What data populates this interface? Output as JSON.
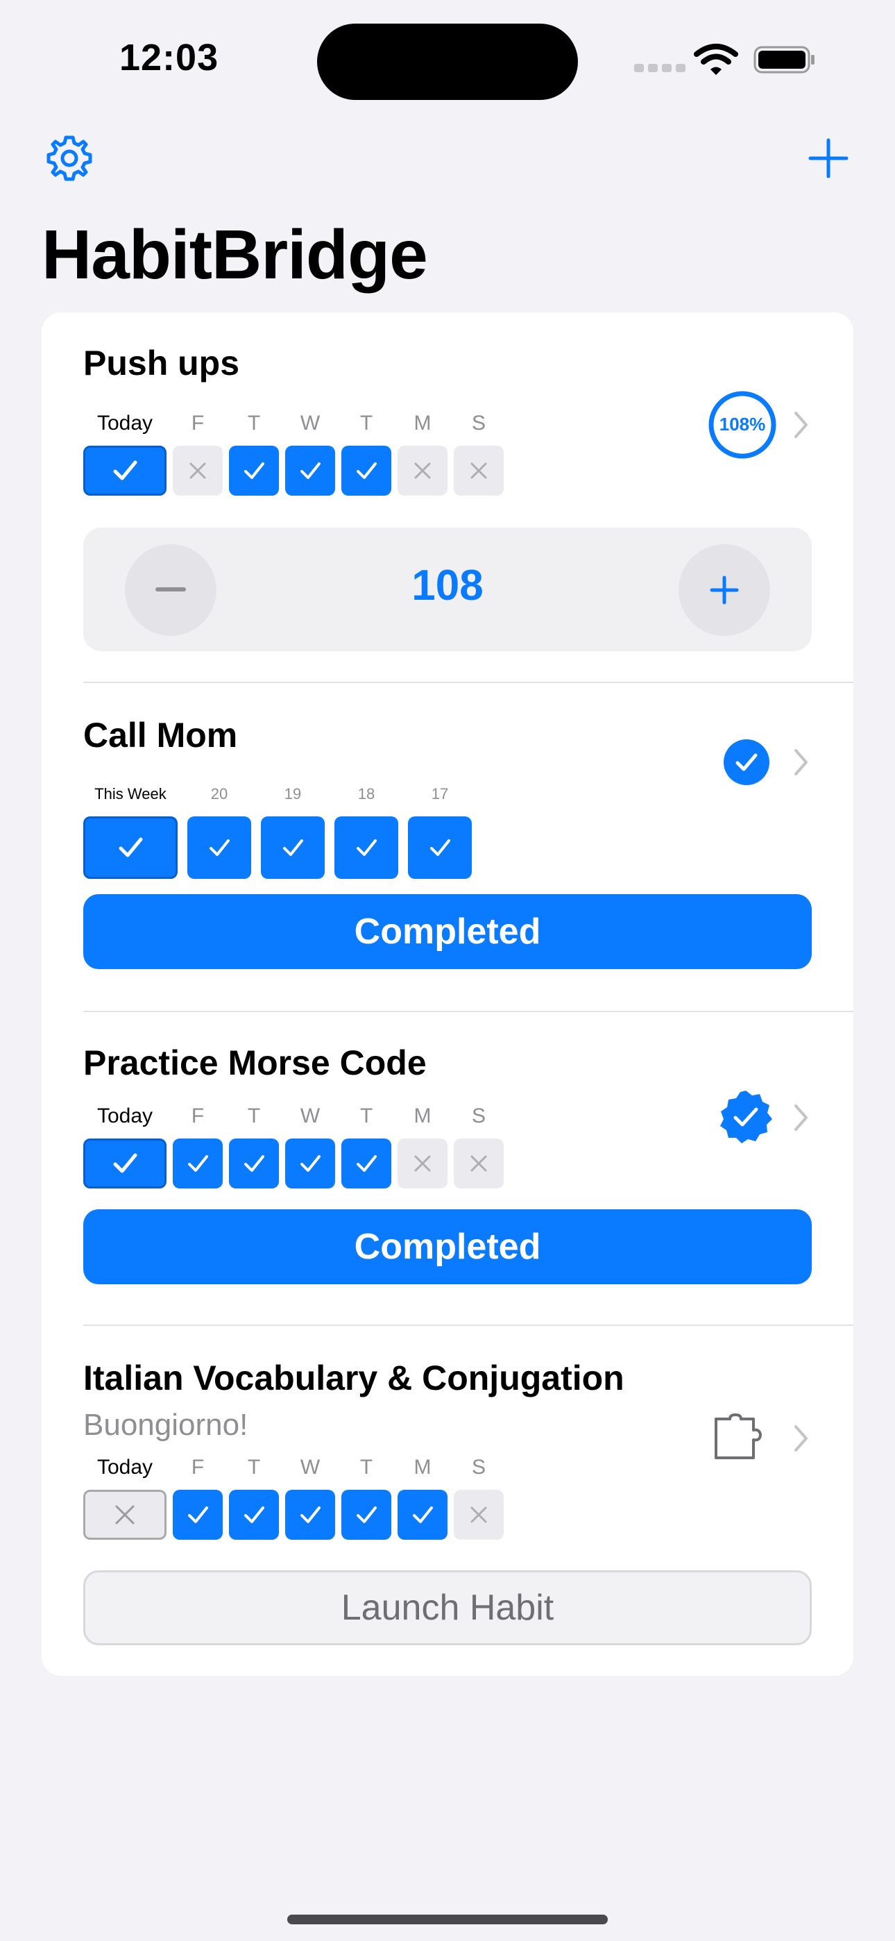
{
  "status_bar": {
    "time": "12:03"
  },
  "app": {
    "title": "HabitBridge",
    "accent_color": "#0A7AFF"
  },
  "header": {
    "settings_icon": "gear-icon",
    "add_icon": "plus-icon"
  },
  "habits": [
    {
      "title": "Push ups",
      "progress_label": "108%",
      "days": [
        {
          "label": "Today",
          "done": true
        },
        {
          "label": "F",
          "done": false
        },
        {
          "label": "T",
          "done": true
        },
        {
          "label": "W",
          "done": true
        },
        {
          "label": "T",
          "done": true
        },
        {
          "label": "M",
          "done": false
        },
        {
          "label": "S",
          "done": false
        }
      ],
      "counter": {
        "value": "108",
        "decrement_icon": "minus-icon",
        "increment_icon": "plus-icon"
      }
    },
    {
      "title": "Call Mom",
      "status_icon": "check-circle-icon",
      "days": [
        {
          "label": "This Week",
          "done": true
        },
        {
          "label": "20",
          "done": true
        },
        {
          "label": "19",
          "done": true
        },
        {
          "label": "18",
          "done": true
        },
        {
          "label": "17",
          "done": true
        }
      ],
      "button_label": "Completed"
    },
    {
      "title": "Practice Morse Code",
      "status_icon": "checkmark-seal-icon",
      "days": [
        {
          "label": "Today",
          "done": true
        },
        {
          "label": "F",
          "done": true
        },
        {
          "label": "T",
          "done": true
        },
        {
          "label": "W",
          "done": true
        },
        {
          "label": "T",
          "done": true
        },
        {
          "label": "M",
          "done": false
        },
        {
          "label": "S",
          "done": false
        }
      ],
      "button_label": "Completed"
    },
    {
      "title": "Italian Vocabulary & Conjugation",
      "subtitle": "Buongiorno!",
      "status_icon": "puzzle-icon",
      "days": [
        {
          "label": "Today",
          "done": false
        },
        {
          "label": "F",
          "done": true
        },
        {
          "label": "T",
          "done": true
        },
        {
          "label": "W",
          "done": true
        },
        {
          "label": "T",
          "done": true
        },
        {
          "label": "M",
          "done": true
        },
        {
          "label": "S",
          "done": false
        }
      ],
      "button_label": "Launch Habit"
    }
  ]
}
